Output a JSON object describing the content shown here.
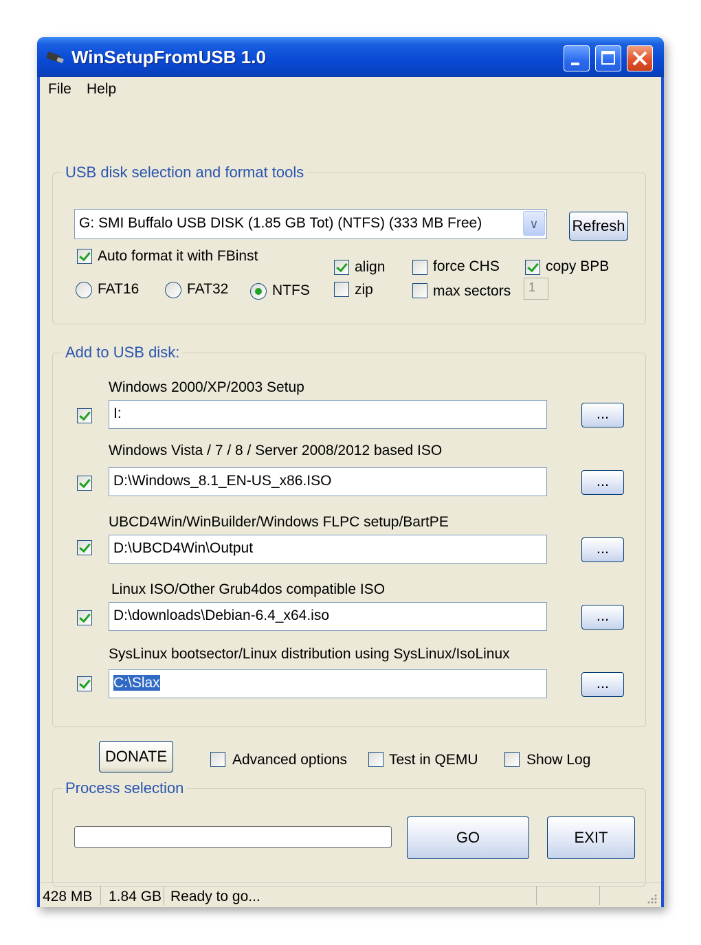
{
  "window": {
    "title": "WinSetupFromUSB 1.0"
  },
  "menu": {
    "file": "File",
    "help": "Help"
  },
  "disk_group": {
    "legend": "USB disk selection and format tools",
    "selected_disk": "G: SMI Buffalo USB DISK (1.85 GB Tot) (NTFS) (333 MB Free)",
    "refresh_label": "Refresh",
    "auto_format_label": "Auto format it with FBinst",
    "auto_format_checked": true,
    "fs_options": [
      "FAT16",
      "FAT32",
      "NTFS"
    ],
    "fs_selected": "NTFS",
    "align_label": "align",
    "align_checked": true,
    "zip_label": "zip",
    "zip_checked": false,
    "force_chs_label": "force CHS",
    "force_chs_checked": false,
    "max_sectors_label": "max sectors",
    "max_sectors_checked": false,
    "max_sectors_value": "1",
    "copy_bpb_label": "copy BPB",
    "copy_bpb_checked": true
  },
  "add_group": {
    "legend": "Add to USB disk:",
    "items": [
      {
        "label": "Windows 2000/XP/2003 Setup",
        "value": "I:",
        "checked": true
      },
      {
        "label": "Windows Vista / 7 / 8 / Server 2008/2012 based ISO",
        "value": "D:\\Windows_8.1_EN-US_x86.ISO",
        "checked": true
      },
      {
        "label": "UBCD4Win/WinBuilder/Windows FLPC setup/BartPE",
        "value": "D:\\UBCD4Win\\Output",
        "checked": true
      },
      {
        "label": "Linux ISO/Other Grub4dos compatible ISO",
        "value": "D:\\downloads\\Debian-6.4_x64.iso",
        "checked": true
      },
      {
        "label": "SysLinux bootsector/Linux distribution using SysLinux/IsoLinux",
        "value": "C:\\Slax",
        "checked": true
      }
    ],
    "browse_label": "..."
  },
  "options": {
    "donate_label": "DONATE",
    "advanced_label": "Advanced options",
    "advanced_checked": false,
    "qemu_label": "Test in QEMU",
    "qemu_checked": false,
    "showlog_label": "Show Log",
    "showlog_checked": false
  },
  "process_group": {
    "legend": "Process selection",
    "progress": 0,
    "go_label": "GO",
    "exit_label": "EXIT"
  },
  "status": {
    "panel1": "428 MB",
    "panel2": "1.84 GB",
    "panel3": "Ready to go..."
  },
  "colors": {
    "title_bar": "#0a4bd6",
    "window_face": "#ece9d8",
    "group_legend": "#2a55b0",
    "check_mark": "#21a121",
    "selection": "#316ac5"
  }
}
